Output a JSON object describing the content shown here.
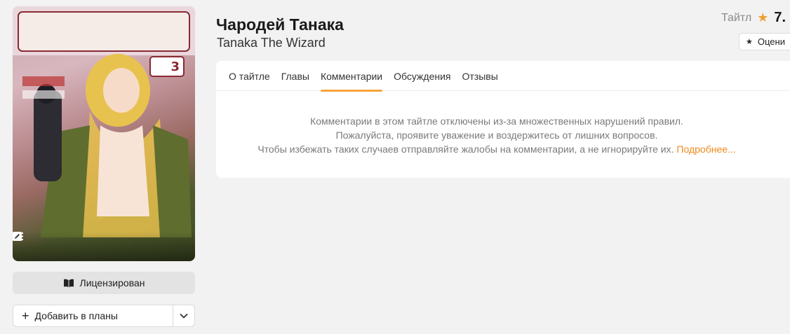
{
  "cover": {
    "volume_number": "3",
    "actions": [
      {
        "icon": "warning-icon"
      },
      {
        "icon": "list-icon"
      },
      {
        "icon": "add-icon"
      },
      {
        "icon": "edit-icon"
      }
    ]
  },
  "licensed_label": "Лицензирован",
  "add_to_plans_label": "Добавить в планы",
  "title_ru": "Чародей Танака",
  "title_en": "Tanaka The Wizard",
  "type_label": "Тайтл",
  "rating_value": "7.",
  "rate_label": "Оцени",
  "tabs": [
    {
      "label": "О тайтле",
      "active": false
    },
    {
      "label": "Главы",
      "active": false
    },
    {
      "label": "Комментарии",
      "active": true
    },
    {
      "label": "Обсуждения",
      "active": false
    },
    {
      "label": "Отзывы",
      "active": false
    }
  ],
  "notice": {
    "line1": "Комментарии в этом тайтле отключены из-за множественных нарушений правил.",
    "line2": "Пожалуйста, проявите уважение и воздержитесь от лишних вопросов.",
    "line3": "Чтобы избежать таких случаев отправляйте жалобы на комментарии, а не игнорируйте их.",
    "more_link": "Подробнее..."
  },
  "colors": {
    "accent": "#f7a43a",
    "link": "#f08a1c",
    "background": "#f2f2f2"
  }
}
